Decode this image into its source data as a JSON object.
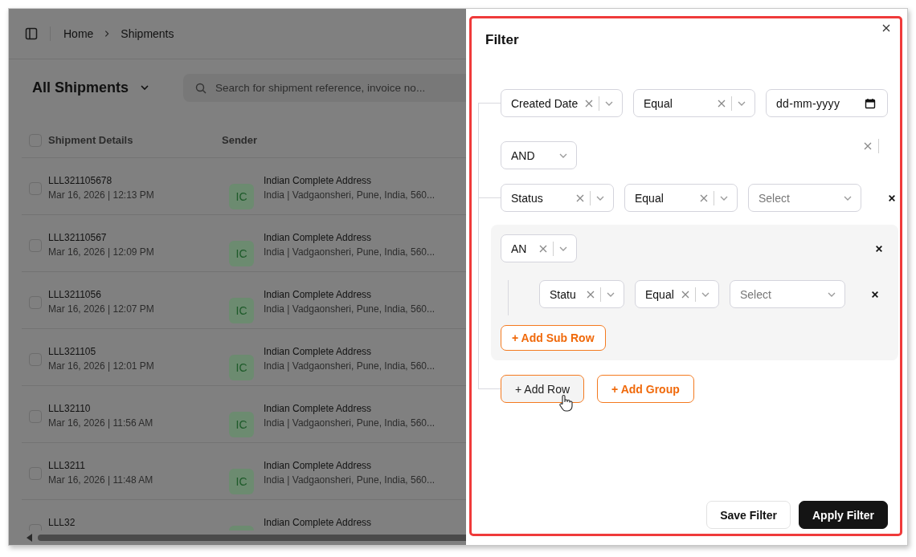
{
  "breadcrumb": [
    "Home",
    "Shipments"
  ],
  "view_title": "All Shipments",
  "search": {
    "placeholder": "Search for shipment reference, invoice no..."
  },
  "table": {
    "all_checked": false,
    "columns": [
      "Shipment Details",
      "Sender"
    ],
    "rows": [
      {
        "checked": false,
        "reference": "LLL321105678",
        "date": "Mar 16, 2026 | 12:13 PM",
        "avatar": "IC",
        "sender_name": "Indian Complete Address",
        "sender_address": "India | Vadgaonsheri, Pune, India, 560..."
      },
      {
        "checked": false,
        "reference": "LLL32110567",
        "date": "Mar 16, 2026 | 12:09 PM",
        "avatar": "IC",
        "sender_name": "Indian Complete Address",
        "sender_address": "India | Vadgaonsheri, Pune, India, 560..."
      },
      {
        "checked": false,
        "reference": "LLL3211056",
        "date": "Mar 16, 2026 | 12:07 PM",
        "avatar": "IC",
        "sender_name": "Indian Complete Address",
        "sender_address": "India | Vadgaonsheri, Pune, India, 560..."
      },
      {
        "checked": false,
        "reference": "LLL321105",
        "date": "Mar 16, 2026 | 12:01 PM",
        "avatar": "IC",
        "sender_name": "Indian Complete Address",
        "sender_address": "India | Vadgaonsheri, Pune, India, 560..."
      },
      {
        "checked": false,
        "reference": "LLL32110",
        "date": "Mar 16, 2026 | 11:56 AM",
        "avatar": "IC",
        "sender_name": "Indian Complete Address",
        "sender_address": "India | Vadgaonsheri, Pune, India, 560..."
      },
      {
        "checked": false,
        "reference": "LLL3211",
        "date": "Mar 16, 2026 | 11:48 AM",
        "avatar": "IC",
        "sender_name": "Indian Complete Address",
        "sender_address": "India | Vadgaonsheri, Pune, India, 560..."
      },
      {
        "checked": false,
        "reference": "LLL32",
        "sender_name": "Indian Complete Address"
      }
    ]
  },
  "filter": {
    "title": "Filter",
    "items": [
      {
        "kind": "rule",
        "removable": false,
        "field": {
          "value": "Created Date",
          "clearable": true
        },
        "operator": {
          "value": "Equal",
          "clearable": true
        },
        "input": {
          "kind": "date",
          "placeholder": "dd-mm-yyyy"
        }
      },
      {
        "kind": "conjunction",
        "value": "AND",
        "clearable": false,
        "stray_clear": true
      },
      {
        "kind": "rule",
        "removable": true,
        "field": {
          "value": "Status",
          "clearable": true
        },
        "operator": {
          "value": "Equal",
          "clearable": true
        },
        "input": {
          "kind": "select",
          "placeholder": "Select"
        }
      },
      {
        "kind": "group",
        "conjunction": {
          "value": "AN",
          "clearable": true
        },
        "removable": true,
        "rules": [
          {
            "kind": "rule",
            "removable": true,
            "field": {
              "value": "Statu",
              "clearable": true
            },
            "operator": {
              "value": "Equal",
              "clearable": true
            },
            "input": {
              "kind": "select",
              "placeholder": "Select"
            }
          }
        ],
        "add_button": {
          "label": "+ Add Sub Row",
          "hovered": false
        }
      }
    ],
    "actions": [
      {
        "label": "+ Add Row",
        "hovered": true
      },
      {
        "label": "+ Add Group",
        "hovered": false
      }
    ],
    "footer": [
      {
        "label": "Save Filter",
        "kind": "secondary"
      },
      {
        "label": "Apply Filter",
        "kind": "primary"
      }
    ]
  }
}
